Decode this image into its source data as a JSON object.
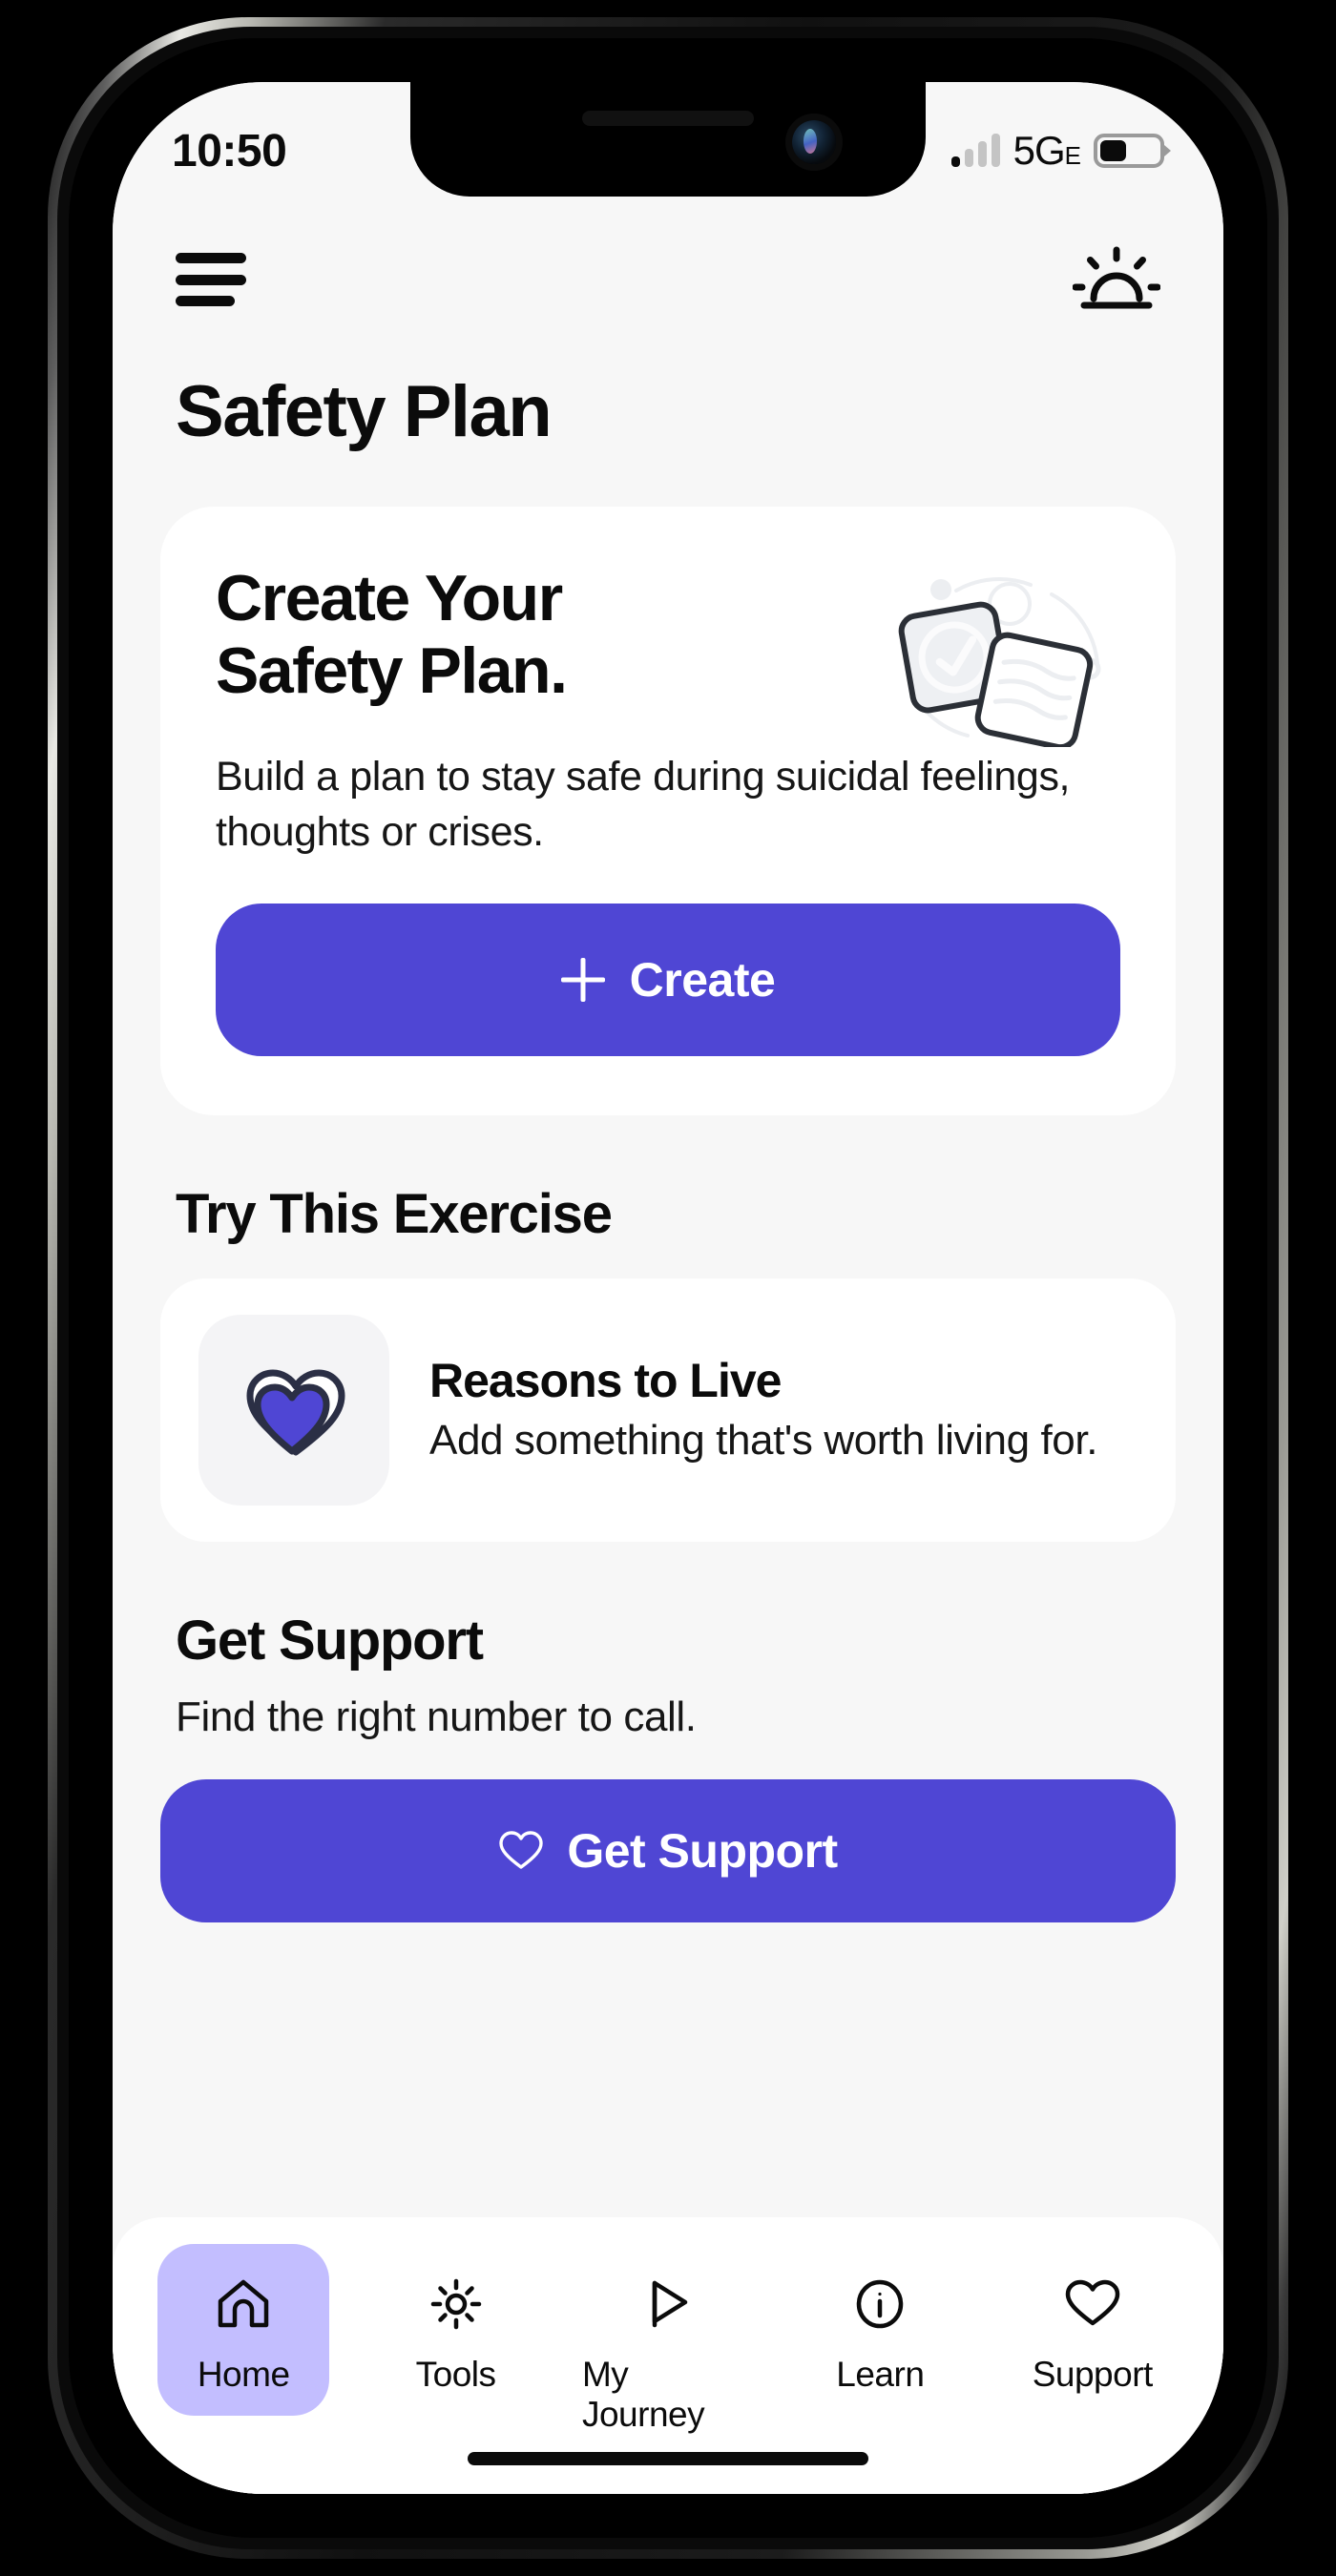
{
  "status_bar": {
    "time": "10:50",
    "network": "5G",
    "network_suffix": "E",
    "signal_bars_total": 4,
    "signal_bars_filled": 1,
    "battery_percent": 45
  },
  "app_bar": {
    "menu_icon": "hamburger-menu-icon",
    "theme_icon": "sunrise-icon"
  },
  "page": {
    "title": "Safety Plan"
  },
  "hero_card": {
    "heading_line1": "Create Your",
    "heading_line2": "Safety Plan.",
    "body": "Build a plan to stay safe during suicidal feelings, thoughts or crises.",
    "illustration": "two-tilted-note-cards-illustration",
    "button_label": "Create",
    "button_icon": "plus-icon",
    "button_color": "#4f46d4"
  },
  "exercise_section": {
    "title": "Try This Exercise",
    "item": {
      "icon": "double-heart-icon",
      "title": "Reasons to Live",
      "description": "Add something that's worth living for."
    }
  },
  "support_section": {
    "title": "Get Support",
    "subtitle": "Find the right number to call.",
    "button_label": "Get Support",
    "button_icon": "heart-outline-icon",
    "button_color": "#4f46d4"
  },
  "tab_bar": {
    "active_color": "#c3beff",
    "items": [
      {
        "label": "Home",
        "icon": "home-icon",
        "active": true
      },
      {
        "label": "Tools",
        "icon": "sun-brightness-icon",
        "active": false
      },
      {
        "label": "My Journey",
        "icon": "flag-pennant-icon",
        "active": false
      },
      {
        "label": "Learn",
        "icon": "info-circle-icon",
        "active": false
      },
      {
        "label": "Support",
        "icon": "heart-outline-icon",
        "active": false
      }
    ]
  }
}
